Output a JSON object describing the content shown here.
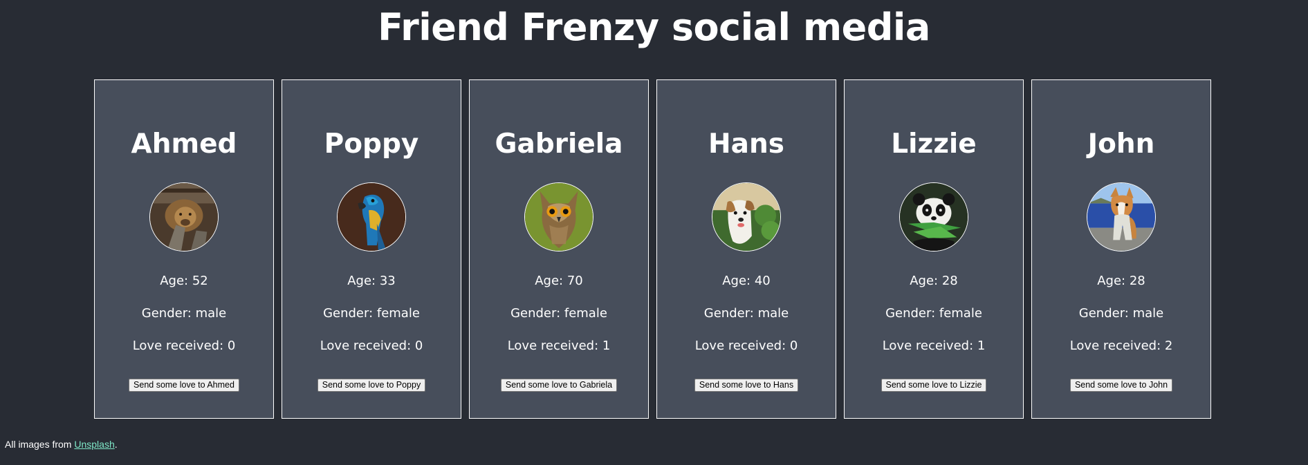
{
  "header": {
    "title": "Friend Frenzy social media"
  },
  "labels": {
    "age_prefix": "Age: ",
    "gender_prefix": "Gender: ",
    "love_prefix": "Love received: ",
    "button_prefix": "Send some love to "
  },
  "friends": [
    {
      "name": "Ahmed",
      "age": "52",
      "gender": "male",
      "love": "0",
      "avatar": "lion",
      "button": "Send some love to Ahmed",
      "age_text": "Age: 52",
      "gender_text": "Gender: male",
      "love_text": "Love received: 0"
    },
    {
      "name": "Poppy",
      "age": "33",
      "gender": "female",
      "love": "0",
      "avatar": "parrot",
      "button": "Send some love to Poppy",
      "age_text": "Age: 33",
      "gender_text": "Gender: female",
      "love_text": "Love received: 0"
    },
    {
      "name": "Gabriela",
      "age": "70",
      "gender": "female",
      "love": "1",
      "avatar": "owl",
      "button": "Send some love to Gabriela",
      "age_text": "Age: 70",
      "gender_text": "Gender: female",
      "love_text": "Love received: 1"
    },
    {
      "name": "Hans",
      "age": "40",
      "gender": "male",
      "love": "0",
      "avatar": "dog",
      "button": "Send some love to Hans",
      "age_text": "Age: 40",
      "gender_text": "Gender: male",
      "love_text": "Love received: 0"
    },
    {
      "name": "Lizzie",
      "age": "28",
      "gender": "female",
      "love": "1",
      "avatar": "panda",
      "button": "Send some love to Lizzie",
      "age_text": "Age: 28",
      "gender_text": "Gender: female",
      "love_text": "Love received: 1"
    },
    {
      "name": "John",
      "age": "28",
      "gender": "male",
      "love": "2",
      "avatar": "corgi",
      "button": "Send some love to John",
      "age_text": "Age: 28",
      "gender_text": "Gender: male",
      "love_text": "Love received: 2"
    }
  ],
  "footer": {
    "prefix": "All images from ",
    "link_text": "Unsplash",
    "suffix": "."
  },
  "colors": {
    "background": "#282c34",
    "card": "#474e5b",
    "link": "#7fe8c8"
  }
}
